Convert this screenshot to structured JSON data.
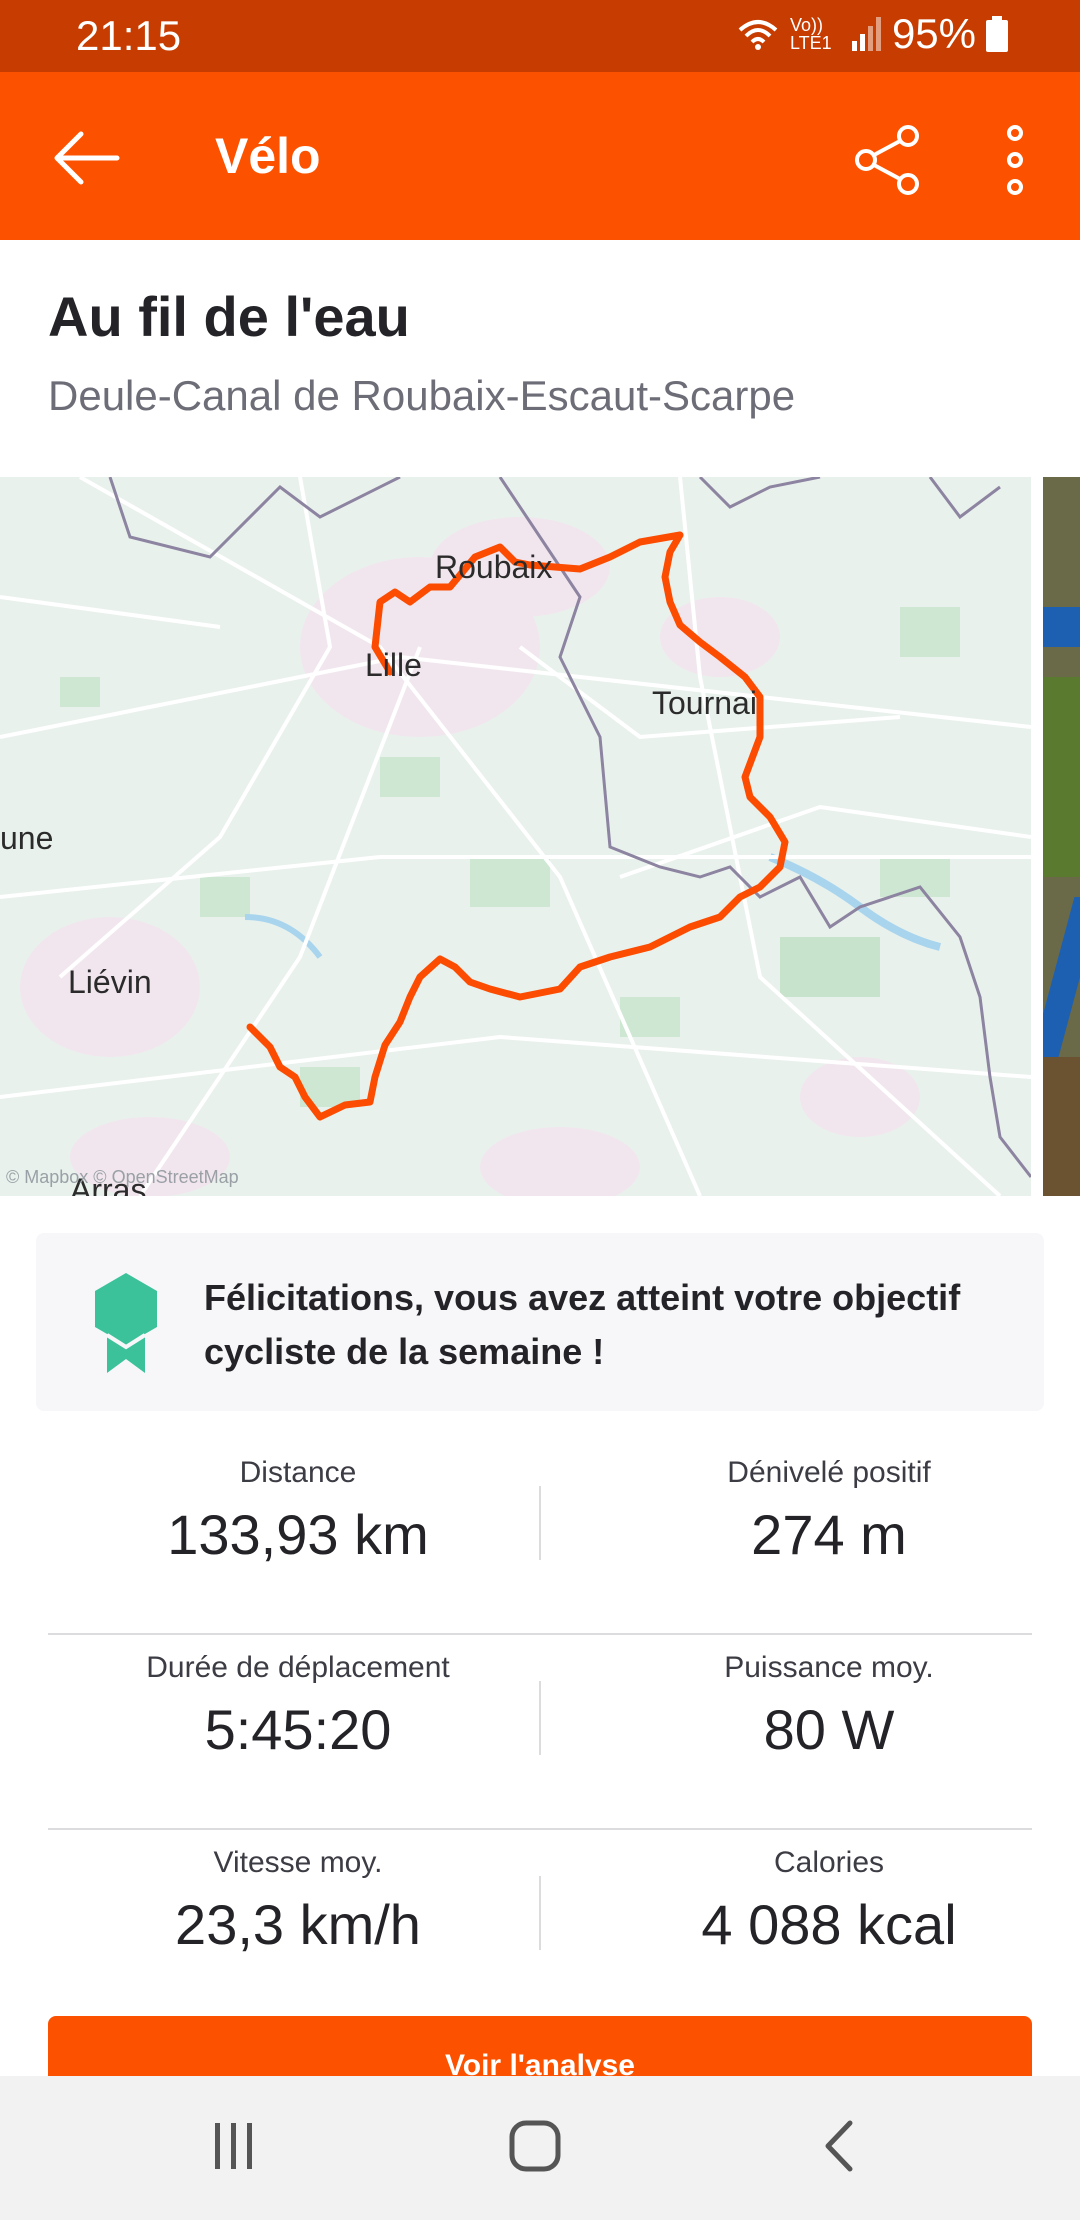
{
  "status_bar": {
    "time": "21:15",
    "network": "Vo)) LTE1",
    "battery": "95%"
  },
  "app_bar": {
    "title": "Vélo",
    "back_icon": "arrow-left-icon",
    "share_icon": "share-icon",
    "more_icon": "more-vertical-icon"
  },
  "activity": {
    "title": "Au fil de l'eau",
    "subtitle": "Deule-Canal de Roubaix-Escaut-Scarpe"
  },
  "map": {
    "labels": {
      "roubaix": "Roubaix",
      "lille": "Lille",
      "tournai": "Tournai",
      "bethune": "une",
      "lievin": "Liévin",
      "arras": "Arras"
    },
    "attribution": "© Mapbox © OpenStreetMap",
    "route_color": "#fc4c02"
  },
  "achievement": {
    "icon": "medal-icon",
    "text": "Félicitations, vous avez atteint votre objectif cycliste de la semaine !"
  },
  "stats": [
    {
      "label": "Distance",
      "value": "133,93 km"
    },
    {
      "label": "Dénivelé positif",
      "value": "274 m"
    },
    {
      "label": "Durée de déplacement",
      "value": "5:45:20"
    },
    {
      "label": "Puissance moy.",
      "value": "80 W"
    },
    {
      "label": "Vitesse moy.",
      "value": "23,3 km/h"
    },
    {
      "label": "Calories",
      "value": "4 088 kcal"
    }
  ],
  "cta": {
    "label": "Voir l'analyse"
  },
  "colors": {
    "brand": "#fc5200",
    "status_bar": "#c73c00",
    "medal": "#3cc29a"
  }
}
